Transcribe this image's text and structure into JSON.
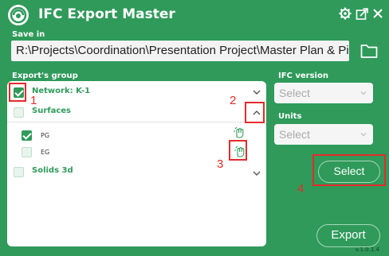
{
  "header": {
    "title": "IFC Export Master",
    "icons": [
      "gear-icon",
      "popout-icon",
      "close-icon"
    ]
  },
  "save": {
    "label": "Save in",
    "path": "R:\\Projects\\Coordination\\Presentation Project\\Master Plan & Pipelin"
  },
  "exports": {
    "label": "Export's group",
    "groups": [
      {
        "label": "Network: K-1",
        "checked": true
      },
      {
        "label": "Surfaces",
        "checked": false,
        "items": [
          {
            "label": "PG",
            "checked": true
          },
          {
            "label": "EG",
            "checked": false
          }
        ]
      },
      {
        "label": "Solids 3d",
        "checked": false
      }
    ]
  },
  "ifc_version": {
    "label": "IFC version",
    "placeholder": "Select"
  },
  "units": {
    "label": "Units",
    "placeholder": "Select"
  },
  "buttons": {
    "select": "Select",
    "export": "Export"
  },
  "annotations": [
    "1",
    "2",
    "3",
    "4"
  ],
  "version": "v.1.0.1.4",
  "colors": {
    "brand": "#2f9a5a",
    "annotation": "#e52b2b"
  }
}
